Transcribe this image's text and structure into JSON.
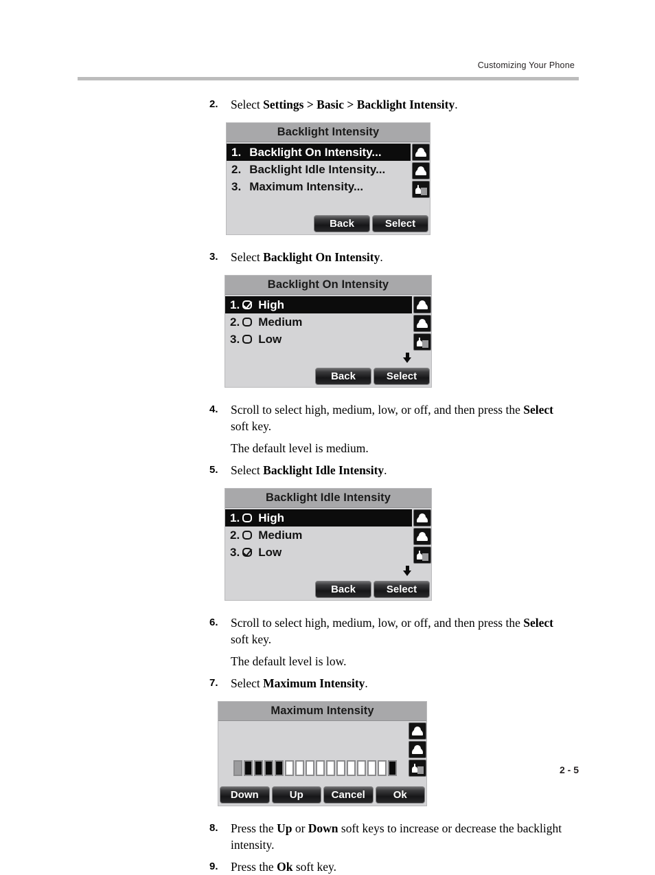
{
  "header": {
    "title": "Customizing Your Phone"
  },
  "footer": {
    "page_number": "2 - 5"
  },
  "steps": {
    "s2": {
      "num": "2.",
      "text_1": "Select ",
      "bold_1": "Settings > Basic > Backlight Intensity",
      "text_2": "."
    },
    "s3": {
      "num": "3.",
      "text_1": "Select ",
      "bold_1": "Backlight On Intensity",
      "text_2": "."
    },
    "s4": {
      "num": "4.",
      "text_1": "Scroll to select high, medium, low, or off, and then press the ",
      "bold_1": "Select",
      "text_2": " soft key.",
      "note": "The default level is medium."
    },
    "s5": {
      "num": "5.",
      "text_1": "Select ",
      "bold_1": "Backlight Idle Intensity",
      "text_2": "."
    },
    "s6": {
      "num": "6.",
      "text_1": "Scroll to select high, medium, low, or off, and then press the ",
      "bold_1": "Select",
      "text_2": " soft key.",
      "note": "The default level is low."
    },
    "s7": {
      "num": "7.",
      "text_1": "Select ",
      "bold_1": "Maximum Intensity",
      "text_2": "."
    },
    "s8": {
      "num": "8.",
      "text_1": "Press the ",
      "bold_1": "Up",
      "text_2": " or ",
      "bold_2": "Down",
      "text_3": " soft keys to increase or decrease the backlight intensity."
    },
    "s9": {
      "num": "9.",
      "text_1": "Press the ",
      "bold_1": "Ok",
      "text_2": " soft key."
    }
  },
  "screens": {
    "backlight_intensity": {
      "title": "Backlight Intensity",
      "rows": [
        {
          "index": "1.",
          "label": "Backlight On Intensity...",
          "selected": true
        },
        {
          "index": "2.",
          "label": "Backlight Idle Intensity...",
          "selected": false
        },
        {
          "index": "3.",
          "label": "Maximum Intensity...",
          "selected": false
        }
      ],
      "softkeys": [
        "Back",
        "Select"
      ]
    },
    "backlight_on_intensity": {
      "title": "Backlight On Intensity",
      "rows": [
        {
          "index": "1.",
          "label": "High",
          "selected": true,
          "checked": true
        },
        {
          "index": "2.",
          "label": "Medium",
          "selected": false,
          "checked": false
        },
        {
          "index": "3.",
          "label": "Low",
          "selected": false,
          "checked": false
        }
      ],
      "softkeys": [
        "Back",
        "Select"
      ],
      "scroll_indicator": "down-arrow"
    },
    "backlight_idle_intensity": {
      "title": "Backlight Idle Intensity",
      "rows": [
        {
          "index": "1.",
          "label": "High",
          "selected": true,
          "checked": false
        },
        {
          "index": "2.",
          "label": "Medium",
          "selected": false,
          "checked": false
        },
        {
          "index": "3.",
          "label": "Low",
          "selected": false,
          "checked": true
        }
      ],
      "softkeys": [
        "Back",
        "Select"
      ],
      "scroll_indicator": "down-arrow"
    },
    "maximum_intensity": {
      "title": "Maximum Intensity",
      "gauge": {
        "total_segments": 16,
        "filled_segments": 4,
        "cursor_position": 1,
        "edge_segment": 16
      },
      "softkeys": [
        "Down",
        "Up",
        "Cancel",
        "Ok"
      ]
    }
  },
  "colors": {
    "lcd_background": "#d4d4d6",
    "lcd_titlebar": "#a8a8aa",
    "selected_row": "#0c0c0c",
    "header_rule": "#bcbcbc"
  }
}
